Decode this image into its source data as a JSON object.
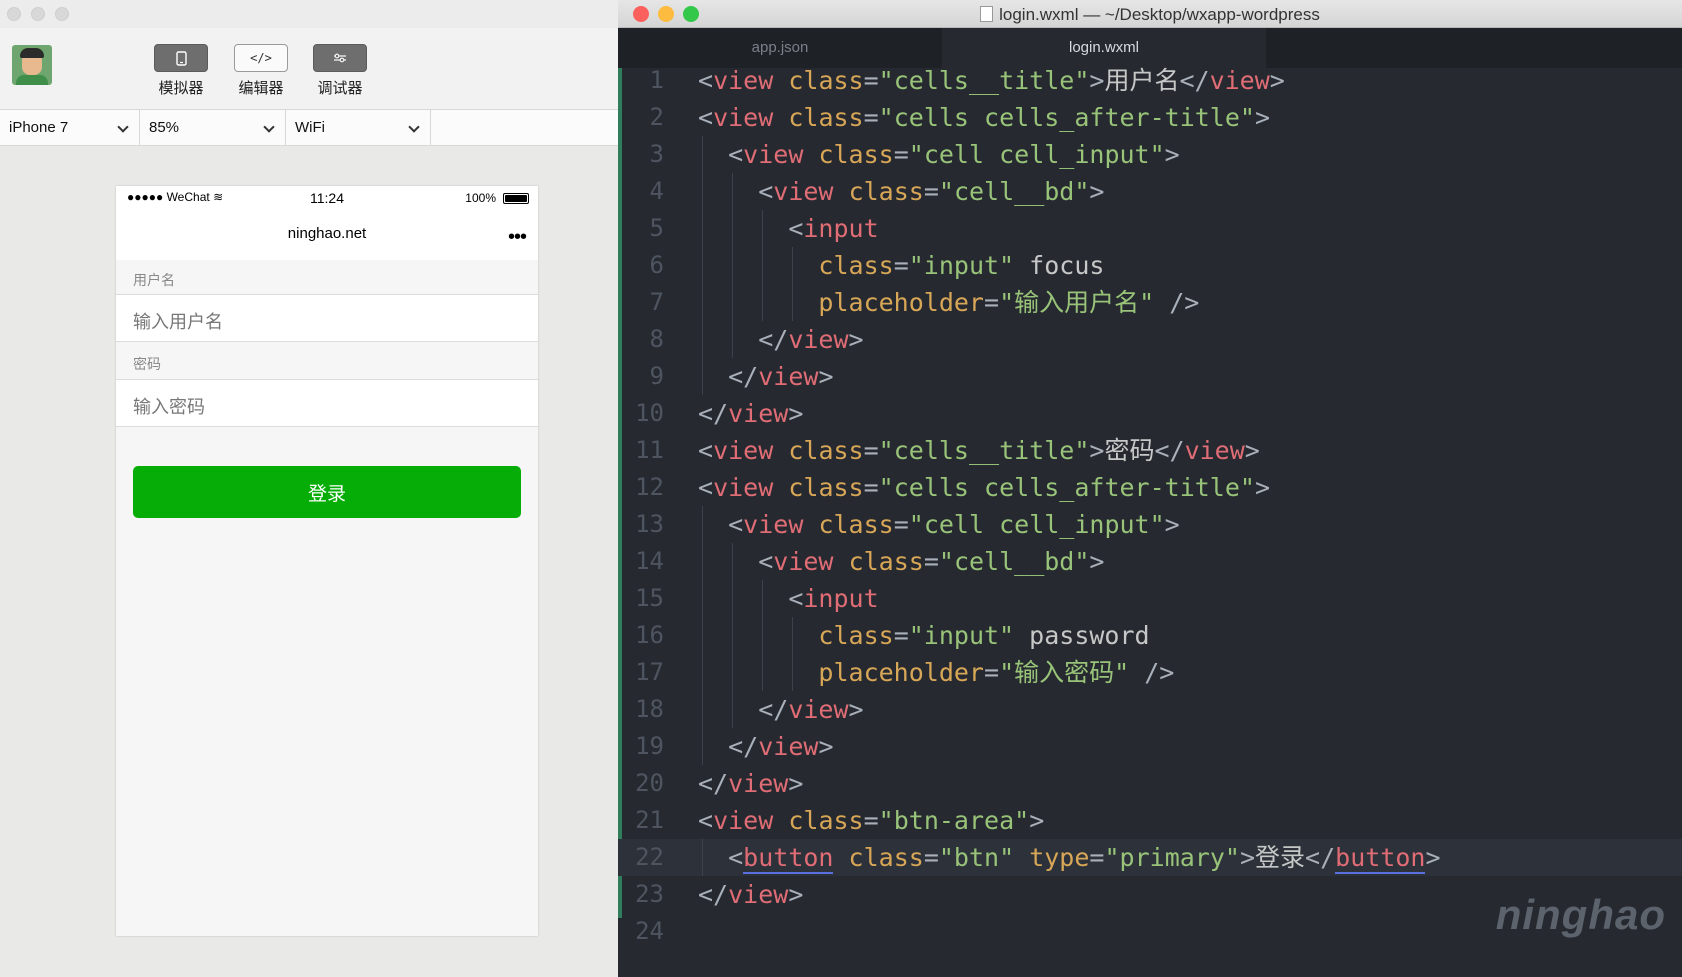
{
  "devtools": {
    "toolbar": {
      "simulator_label": "模拟器",
      "editor_label": "编辑器",
      "debugger_label": "调试器"
    },
    "device": "iPhone 7",
    "zoom": "85%",
    "network": "WiFi",
    "phone": {
      "carrier": "●●●●● WeChat",
      "time": "11:24",
      "battery": "100%",
      "nav_title": "ninghao.net",
      "more": "•••",
      "username_title": "用户名",
      "username_placeholder": "输入用户名",
      "password_title": "密码",
      "password_placeholder": "输入密码",
      "login_button": "登录"
    }
  },
  "editor": {
    "window_title": "login.wxml — ~/Desktop/wxapp-wordpress",
    "tabs": [
      "app.json",
      "login.wxml"
    ],
    "active_tab": "login.wxml",
    "highlight_line": 22,
    "lines": [
      "<view class=\"cells__title\">用户名</view>",
      "<view class=\"cells cells_after-title\">",
      "  <view class=\"cell cell_input\">",
      "    <view class=\"cell__bd\">",
      "      <input",
      "        class=\"input\" focus",
      "        placeholder=\"输入用户名\" />",
      "    </view>",
      "  </view>",
      "</view>",
      "<view class=\"cells__title\">密码</view>",
      "<view class=\"cells cells_after-title\">",
      "  <view class=\"cell cell_input\">",
      "    <view class=\"cell__bd\">",
      "      <input",
      "        class=\"input\" password",
      "        placeholder=\"输入密码\" />",
      "    </view>",
      "  </view>",
      "</view>",
      "<view class=\"btn-area\">",
      "  <button class=\"btn\" type=\"primary\">登录</button>",
      "</view>",
      ""
    ],
    "watermark": "ninghao"
  },
  "colors": {
    "tag": "#e06c75",
    "attribute": "#d8a657",
    "string": "#98c379",
    "login_button": "#06ad06",
    "close": "#fc605c",
    "minimize": "#fdbc40",
    "zoom": "#34c84a"
  }
}
